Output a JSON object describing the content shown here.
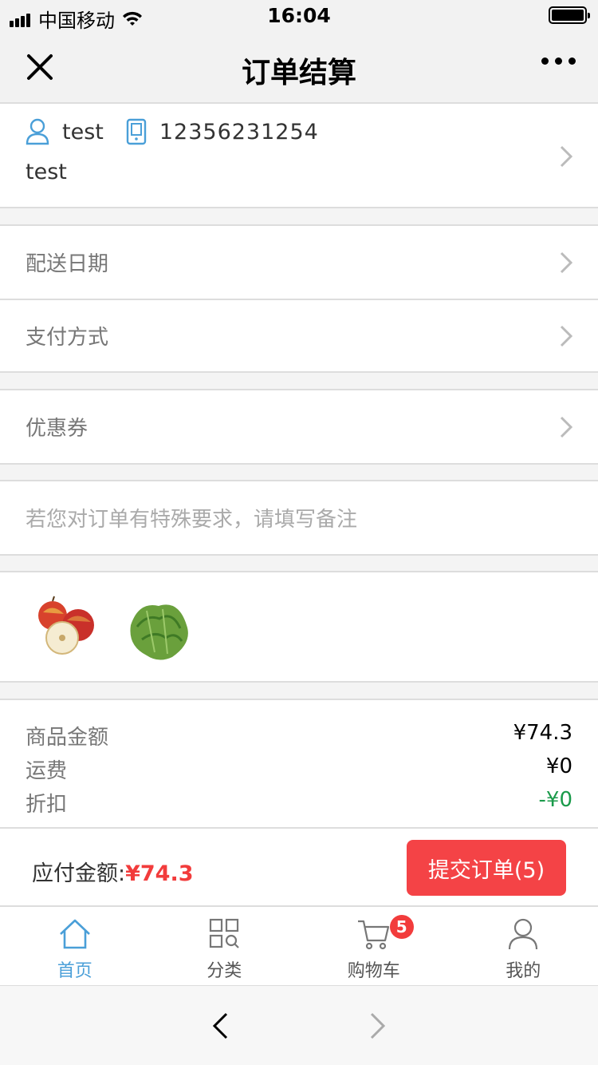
{
  "status_bar": {
    "carrier": "中国移动",
    "time": "16:04"
  },
  "nav": {
    "title": "订单结算"
  },
  "address": {
    "name": "test",
    "phone": "12356231254",
    "detail": "test"
  },
  "options": {
    "delivery_date": "配送日期",
    "payment_method": "支付方式",
    "coupon": "优惠券"
  },
  "remark": {
    "placeholder": "若您对订单有特殊要求，请填写备注"
  },
  "goods": {
    "items": [
      "apple-image",
      "lettuce-image"
    ]
  },
  "summary": {
    "goods_amount_label": "商品金额",
    "goods_amount": "¥74.3",
    "shipping_label": "运费",
    "shipping": "¥0",
    "discount_label": "折扣",
    "discount": "-¥0"
  },
  "pay": {
    "label": "应付金额:",
    "amount": "¥74.3",
    "submit_label": "提交订单(5)"
  },
  "tabs": [
    {
      "label": "首页",
      "icon": "home-icon",
      "active": true
    },
    {
      "label": "分类",
      "icon": "category-icon",
      "active": false
    },
    {
      "label": "购物车",
      "icon": "cart-icon",
      "active": false,
      "badge": "5"
    },
    {
      "label": "我的",
      "icon": "user-icon",
      "active": false
    }
  ],
  "colors": {
    "accent": "#4a9fd8",
    "price": "#f23c3c",
    "submit": "#f44346",
    "discount": "#1a9a4a"
  }
}
